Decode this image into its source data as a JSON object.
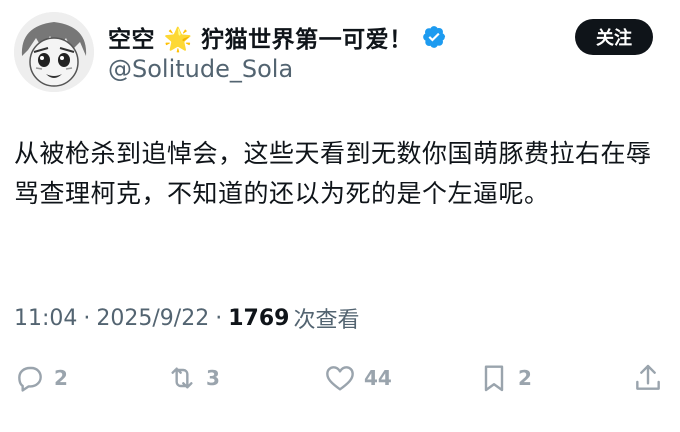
{
  "author": {
    "display_name": "空空 🌟 狞猫世界第一可爱！",
    "handle": "@Solitude_Sola",
    "verified": true,
    "verified_color": "#1d9bf0"
  },
  "follow_button": {
    "label": "关注"
  },
  "tweet": {
    "text": "从被枪杀到追悼会，这些天看到无数你国萌豚费拉右在辱骂查理柯克，不知道的还以为死的是个左逼呢。"
  },
  "meta": {
    "time": "11:04",
    "date": "2025/9/22",
    "views_count": "1769",
    "views_label": "次查看",
    "separator": "·"
  },
  "actions": {
    "reply_count": "2",
    "retweet_count": "3",
    "like_count": "44",
    "bookmark_count": "2"
  },
  "colors": {
    "text": "#0f1419",
    "muted": "#536471",
    "icon": "#9aa4ad",
    "button_bg": "#0f1419"
  }
}
